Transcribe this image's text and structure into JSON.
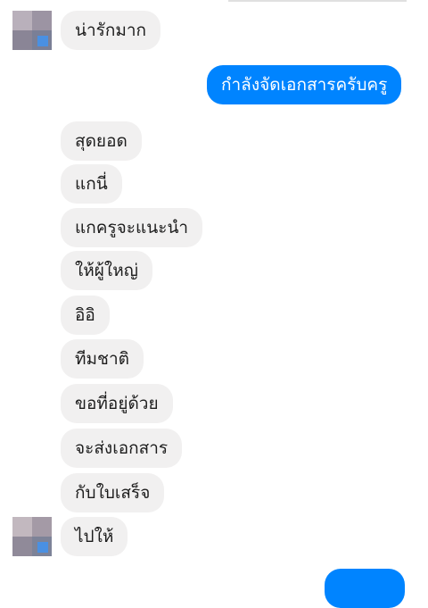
{
  "colors": {
    "incoming_bubble": "#f1f0f0",
    "outgoing_bubble": "#0084ff",
    "incoming_text": "#1d1d1d",
    "outgoing_text": "#ffffff"
  },
  "messages": [
    {
      "from": "contact",
      "text": "น่ารักมาก"
    },
    {
      "from": "me",
      "text": "กำลังจัดเอกสารครับครู"
    },
    {
      "from": "contact",
      "text": "สุดยอด"
    },
    {
      "from": "contact",
      "text": "แกนี่"
    },
    {
      "from": "contact",
      "text": "แกครูจะแนะนำ"
    },
    {
      "from": "contact",
      "text": "ให้ผู้ใหญ่"
    },
    {
      "from": "contact",
      "text": "อิอิ"
    },
    {
      "from": "contact",
      "text": "ทีมชาติ"
    },
    {
      "from": "contact",
      "text": "ขอที่อยู่ด้วย"
    },
    {
      "from": "contact",
      "text": "จะส่งเอกสาร"
    },
    {
      "from": "contact",
      "text": "กับใบเสร็จ"
    },
    {
      "from": "contact",
      "text": "ไปให้"
    }
  ],
  "avatar_icon": "blurred-profile-photo"
}
